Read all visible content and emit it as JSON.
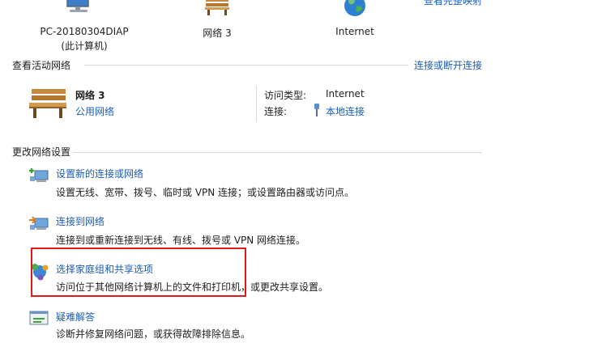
{
  "top": {
    "right_link": "查看完整映射",
    "computer": {
      "name": "PC-20180304DIAP",
      "note": "(此计算机)"
    },
    "network": {
      "name": "网络  3"
    },
    "internet": {
      "name": "Internet"
    }
  },
  "active": {
    "header": "查看活动网络",
    "connect_link": "连接或断开连接",
    "network_name": "网络  3",
    "network_type": "公用网络",
    "access_type_label": "访问类型:",
    "access_type_value": "Internet",
    "connection_label": "连接:",
    "connection_value": "本地连接"
  },
  "change": {
    "header": "更改网络设置",
    "tasks": [
      {
        "title": "设置新的连接或网络",
        "desc": "设置无线、宽带、拨号、临时或 VPN 连接；或设置路由器或访问点。",
        "icon": "new-connection-icon"
      },
      {
        "title": "连接到网络",
        "desc": "连接到或重新连接到无线、有线、拨号或 VPN 网络连接。",
        "icon": "connect-network-icon"
      },
      {
        "title": "选择家庭组和共享选项",
        "desc": "访问位于其他网络计算机上的文件和打印机，或更改共享设置。",
        "icon": "homegroup-icon"
      },
      {
        "title": "疑难解答",
        "desc": "诊断并修复网络问题，或获得故障排除信息。",
        "icon": "troubleshoot-icon"
      }
    ]
  },
  "colors": {
    "link": "#1a5cb8",
    "highlight": "#e0191b",
    "rule": "#d6dbe3"
  }
}
